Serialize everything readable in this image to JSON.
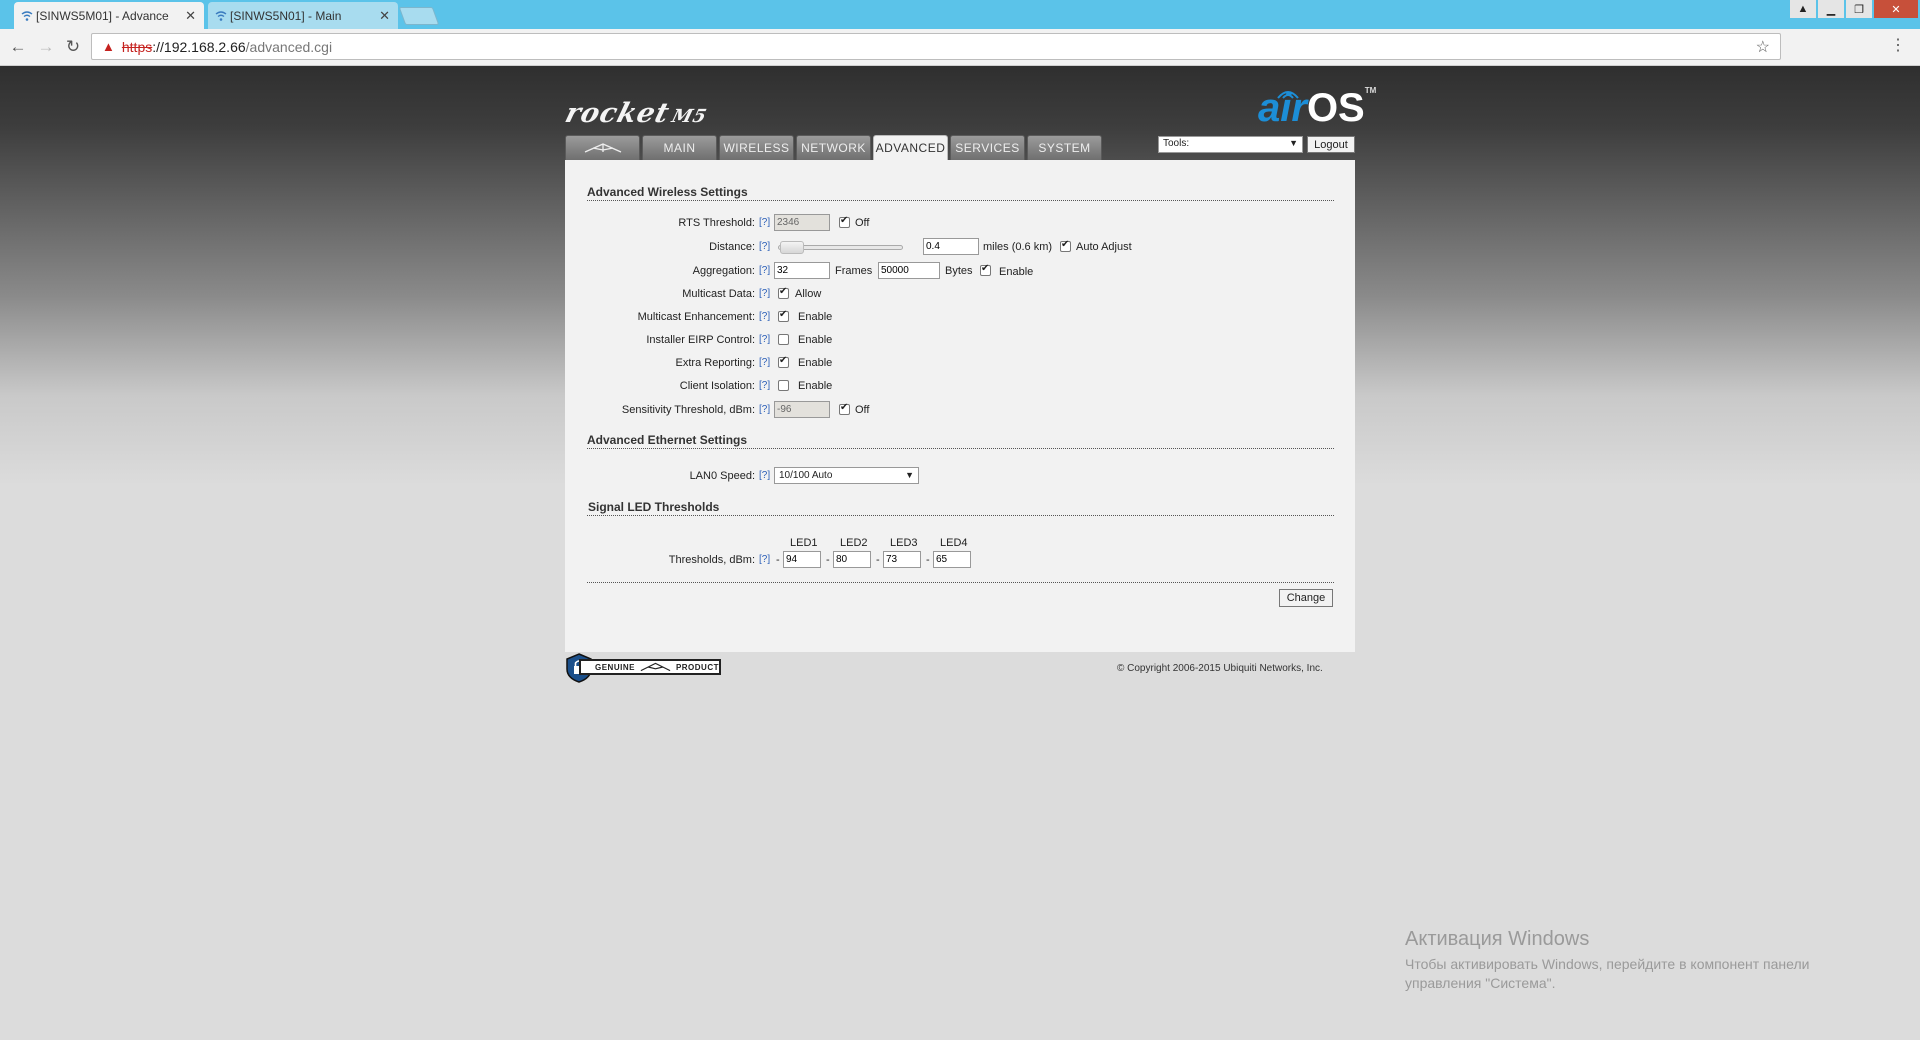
{
  "browser": {
    "tabs": [
      {
        "title": "[SINWS5M01] - Advance",
        "active": true
      },
      {
        "title": "[SINWS5N01] - Main",
        "active": false
      }
    ],
    "url": {
      "scheme": "https",
      "host": "://192.168.2.66",
      "path": "/advanced.cgi"
    }
  },
  "header": {
    "product": "rocket",
    "model": "M5",
    "os_air": "air",
    "os_os": "OS",
    "tm": "TM",
    "tabs": [
      "MAIN",
      "WIRELESS",
      "NETWORK",
      "ADVANCED",
      "SERVICES",
      "SYSTEM"
    ],
    "active_tab": "ADVANCED",
    "tools_label": "Tools:",
    "logout_label": "Logout"
  },
  "wireless": {
    "title": "Advanced Wireless Settings",
    "help": "[?]",
    "rts_label": "RTS Threshold:",
    "rts_value": "2346",
    "rts_off": "Off",
    "distance_label": "Distance:",
    "distance_value": "0.4",
    "distance_unit": "miles (0.6 km)",
    "auto_adjust": "Auto Adjust",
    "aggregation_label": "Aggregation:",
    "agg_frames_value": "32",
    "agg_frames_unit": "Frames",
    "agg_bytes_value": "50000",
    "agg_bytes_unit": "Bytes",
    "agg_enable": "Enable",
    "multicast_label": "Multicast Data:",
    "multicast_allow": "Allow",
    "mc_enh_label": "Multicast Enhancement:",
    "installer_label": "Installer EIRP Control:",
    "extra_label": "Extra Reporting:",
    "isolation_label": "Client Isolation:",
    "enable": "Enable",
    "sens_label": "Sensitivity Threshold, dBm:",
    "sens_value": "-96",
    "sens_off": "Off"
  },
  "ethernet": {
    "title": "Advanced Ethernet Settings",
    "lan_label": "LAN0 Speed:",
    "lan_value": "10/100 Auto"
  },
  "led": {
    "title": "Signal LED Thresholds",
    "headers": [
      "LED1",
      "LED2",
      "LED3",
      "LED4"
    ],
    "label": "Thresholds, dBm:",
    "values": [
      "94",
      "80",
      "73",
      "65"
    ],
    "dash": "-"
  },
  "footer": {
    "change": "Change",
    "badge_left": "GENUINE",
    "badge_right": "PRODUCT",
    "copyright": "© Copyright 2006-2015 Ubiquiti Networks, Inc."
  },
  "windows": {
    "title": "Активация Windows",
    "text": "Чтобы активировать Windows, перейдите в компонент панели управления \"Система\"."
  }
}
